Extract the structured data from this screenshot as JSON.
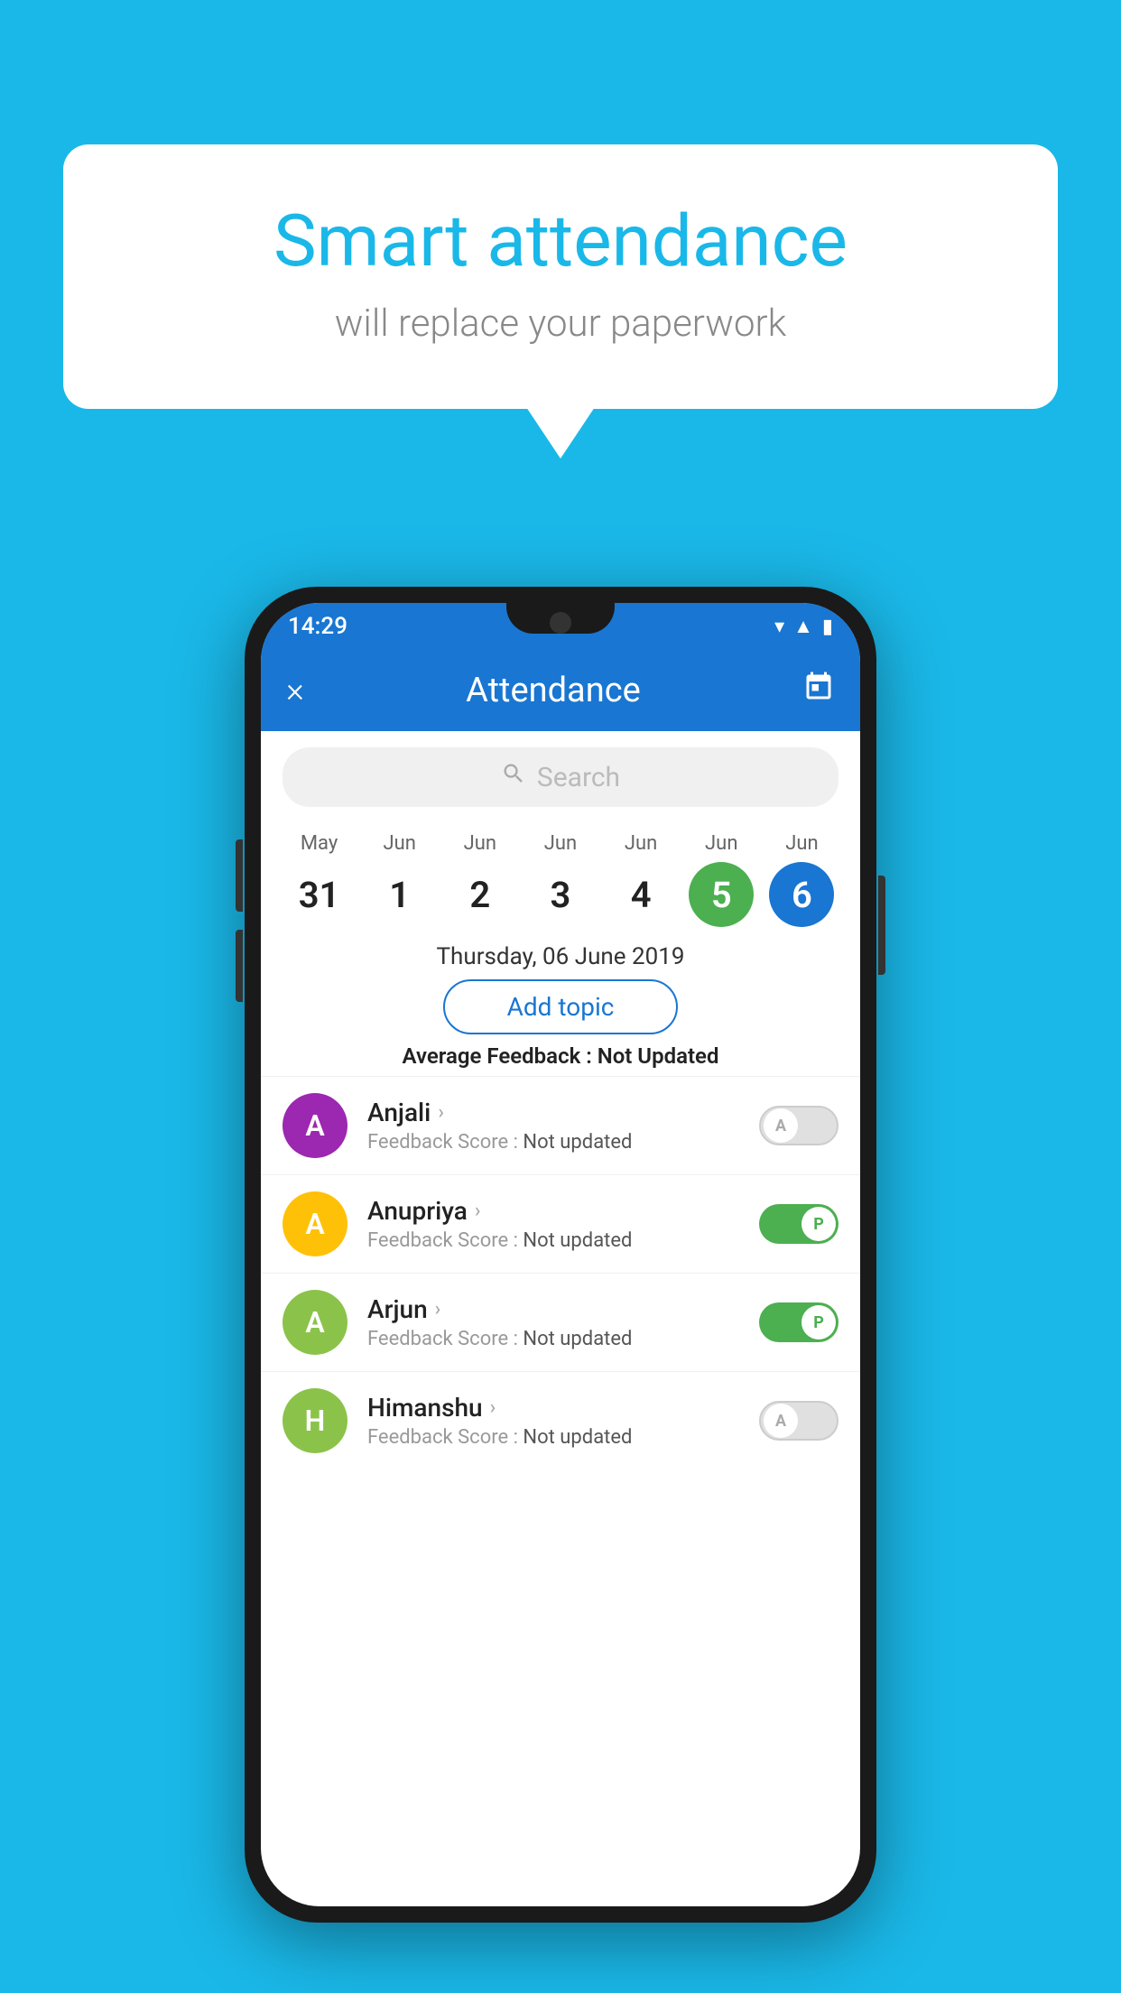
{
  "page": {
    "background_color": "#1ab8e8"
  },
  "speech_bubble": {
    "title": "Smart attendance",
    "subtitle": "will replace your paperwork"
  },
  "status_bar": {
    "time": "14:29",
    "icons": [
      "wifi",
      "signal",
      "battery"
    ]
  },
  "header": {
    "title": "Attendance",
    "close_label": "×",
    "calendar_icon": "📅"
  },
  "search": {
    "placeholder": "Search"
  },
  "calendar": {
    "days": [
      {
        "month": "May",
        "date": "31",
        "state": "normal"
      },
      {
        "month": "Jun",
        "date": "1",
        "state": "normal"
      },
      {
        "month": "Jun",
        "date": "2",
        "state": "normal"
      },
      {
        "month": "Jun",
        "date": "3",
        "state": "normal"
      },
      {
        "month": "Jun",
        "date": "4",
        "state": "normal"
      },
      {
        "month": "Jun",
        "date": "5",
        "state": "today"
      },
      {
        "month": "Jun",
        "date": "6",
        "state": "selected"
      }
    ],
    "selected_date_label": "Thursday, 06 June 2019"
  },
  "add_topic": {
    "label": "Add topic"
  },
  "avg_feedback": {
    "label": "Average Feedback :",
    "value": "Not Updated"
  },
  "students": [
    {
      "name": "Anjali",
      "avatar_letter": "A",
      "avatar_color": "#9c27b0",
      "feedback_label": "Feedback Score :",
      "feedback_value": "Not updated",
      "attendance": "absent",
      "toggle_letter": "A"
    },
    {
      "name": "Anupriya",
      "avatar_letter": "A",
      "avatar_color": "#ffc107",
      "feedback_label": "Feedback Score :",
      "feedback_value": "Not updated",
      "attendance": "present",
      "toggle_letter": "P"
    },
    {
      "name": "Arjun",
      "avatar_letter": "A",
      "avatar_color": "#8bc34a",
      "feedback_label": "Feedback Score :",
      "feedback_value": "Not updated",
      "attendance": "present",
      "toggle_letter": "P"
    },
    {
      "name": "Himanshu",
      "avatar_letter": "H",
      "avatar_color": "#8bc34a",
      "feedback_label": "Feedback Score :",
      "feedback_value": "Not updated",
      "attendance": "absent",
      "toggle_letter": "A"
    }
  ]
}
